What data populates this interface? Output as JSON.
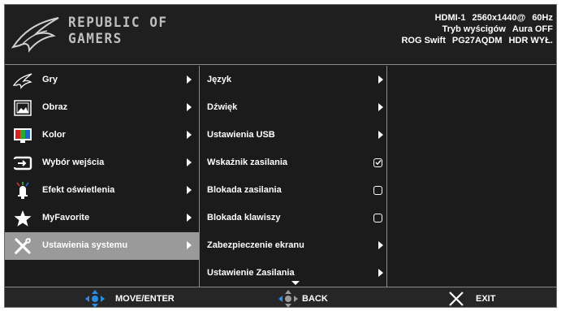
{
  "brand": {
    "line1": "REPUBLIC OF",
    "line2": "GAMERS"
  },
  "status": {
    "row1": [
      "HDMI-1",
      "2560x1440@",
      "60Hz"
    ],
    "row2": [
      "Tryb wyścigów",
      "Aura OFF"
    ],
    "row3": [
      "ROG Swift",
      "PG27AQDM",
      "HDR WYŁ."
    ]
  },
  "main_menu": {
    "items": [
      {
        "label": "Gry",
        "icon": "rog-claw-icon"
      },
      {
        "label": "Obraz",
        "icon": "image-icon"
      },
      {
        "label": "Kolor",
        "icon": "color-bars-icon"
      },
      {
        "label": "Wybór wejścia",
        "icon": "input-icon"
      },
      {
        "label": "Efekt oświetlenia",
        "icon": "lighting-icon"
      },
      {
        "label": "MyFavorite",
        "icon": "star-icon"
      },
      {
        "label": "Ustawienia systemu",
        "icon": "wrench-screwdriver-icon",
        "active": true
      }
    ]
  },
  "sub_menu": {
    "items": [
      {
        "label": "Język",
        "control": "arrow"
      },
      {
        "label": "Dźwięk",
        "control": "arrow"
      },
      {
        "label": "Ustawienia USB",
        "control": "arrow"
      },
      {
        "label": "Wskaźnik zasilania",
        "control": "checkbox",
        "checked": true
      },
      {
        "label": "Blokada zasilania",
        "control": "checkbox",
        "checked": false
      },
      {
        "label": "Blokada klawiszy",
        "control": "checkbox",
        "checked": false
      },
      {
        "label": "Zabezpieczenie ekranu",
        "control": "arrow"
      },
      {
        "label": "Ustawienie Zasilania",
        "control": "arrow"
      }
    ]
  },
  "footer": {
    "move_enter": "MOVE/ENTER",
    "back": "BACK",
    "exit": "EXIT"
  },
  "colors": {
    "joystick_blue": "#2a8ee6",
    "panel_bg": "#1b1b1b",
    "active_bg": "#9a9a9a"
  }
}
